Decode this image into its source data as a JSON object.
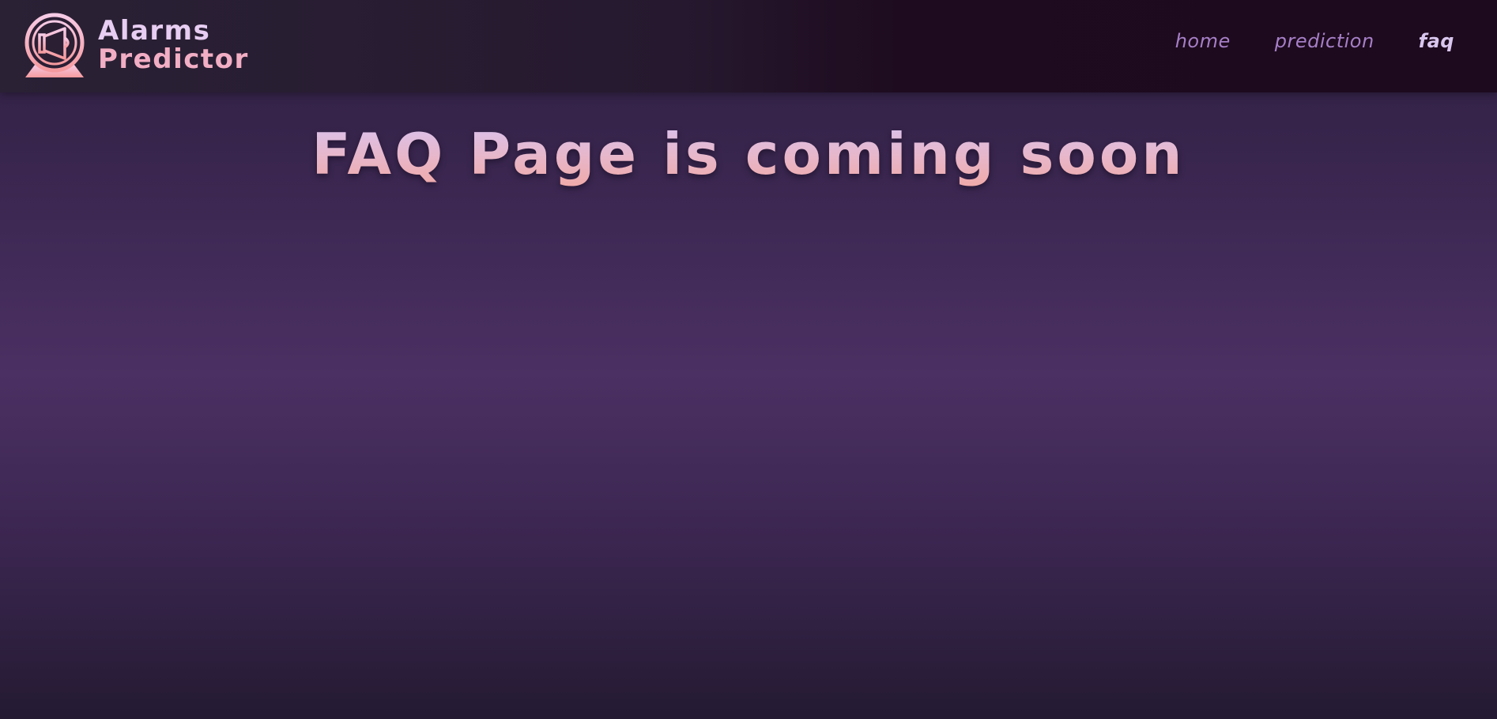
{
  "header": {
    "logo": {
      "line1": "Alarms",
      "line2": "Predictor",
      "icon": "megaphone-icon"
    },
    "nav": {
      "items": [
        {
          "label": "home",
          "active": false
        },
        {
          "label": "prediction",
          "active": false
        },
        {
          "label": "faq",
          "active": true
        }
      ]
    }
  },
  "main": {
    "headline": "FAQ Page is coming soon"
  },
  "colors": {
    "nav_inactive": "#a67fc7",
    "nav_active": "#d9c6ee",
    "accent_pink": "#f2aec4",
    "accent_lilac": "#e7cdf2"
  }
}
